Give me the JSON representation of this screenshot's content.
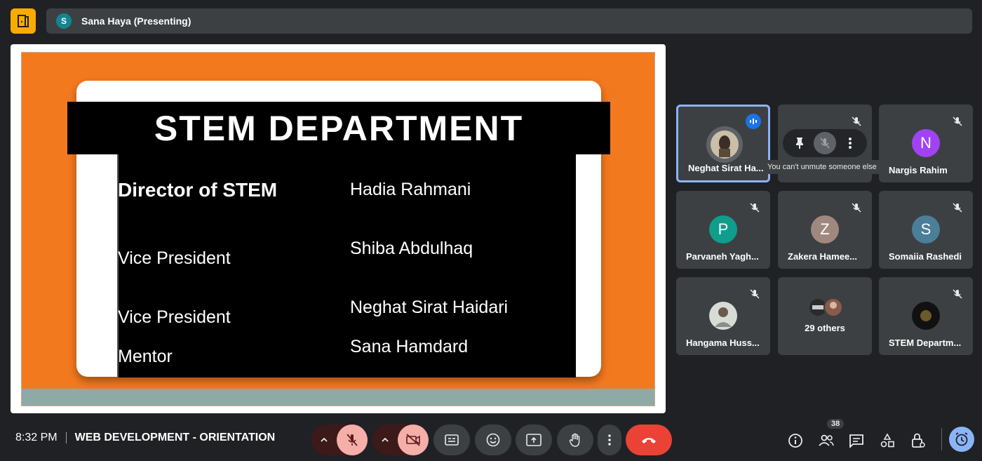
{
  "presenter": {
    "initial": "S",
    "label": "Sana Haya (Presenting)"
  },
  "slide": {
    "title": "STEM DEPARTMENT",
    "rows": [
      {
        "role": "Director of STEM",
        "name": "Hadia Rahmani"
      },
      {
        "role": "Vice President",
        "name": "Shiba Abdulhaq"
      },
      {
        "role": "Vice President",
        "name": "Neghat Sirat Haidari"
      },
      {
        "role": "Mentor",
        "name": "Sana Hamdard"
      }
    ]
  },
  "participants": [
    {
      "name": "Neghat Sirat Ha...",
      "avatar": "photo",
      "speaking": true
    },
    {
      "name": "",
      "avatar": "menu"
    },
    {
      "name": "Nargis Rahim",
      "initial": "N",
      "color": "#a142f4"
    },
    {
      "name": "Parvaneh Yagh...",
      "initial": "P",
      "color": "#0f9d8c"
    },
    {
      "name": "Zakera Hamee...",
      "initial": "Z",
      "color": "#a1887f"
    },
    {
      "name": "Somaiia Rashedi",
      "initial": "S",
      "color": "#4b7e99"
    },
    {
      "name": "Hangama Huss...",
      "avatar": "photo"
    },
    {
      "name": "29 others",
      "avatar": "group"
    },
    {
      "name": "STEM Departm...",
      "avatar": "photo"
    }
  ],
  "hover_tooltip": "You can't unmute someone else",
  "bottom": {
    "time": "8:32 PM",
    "meeting_title": "WEB DEVELOPMENT - ORIENTATION",
    "people_count": "38"
  },
  "colors": {
    "accent": "#8ab4f8",
    "end_call": "#ea4335",
    "slide_bg": "#f3791f"
  }
}
